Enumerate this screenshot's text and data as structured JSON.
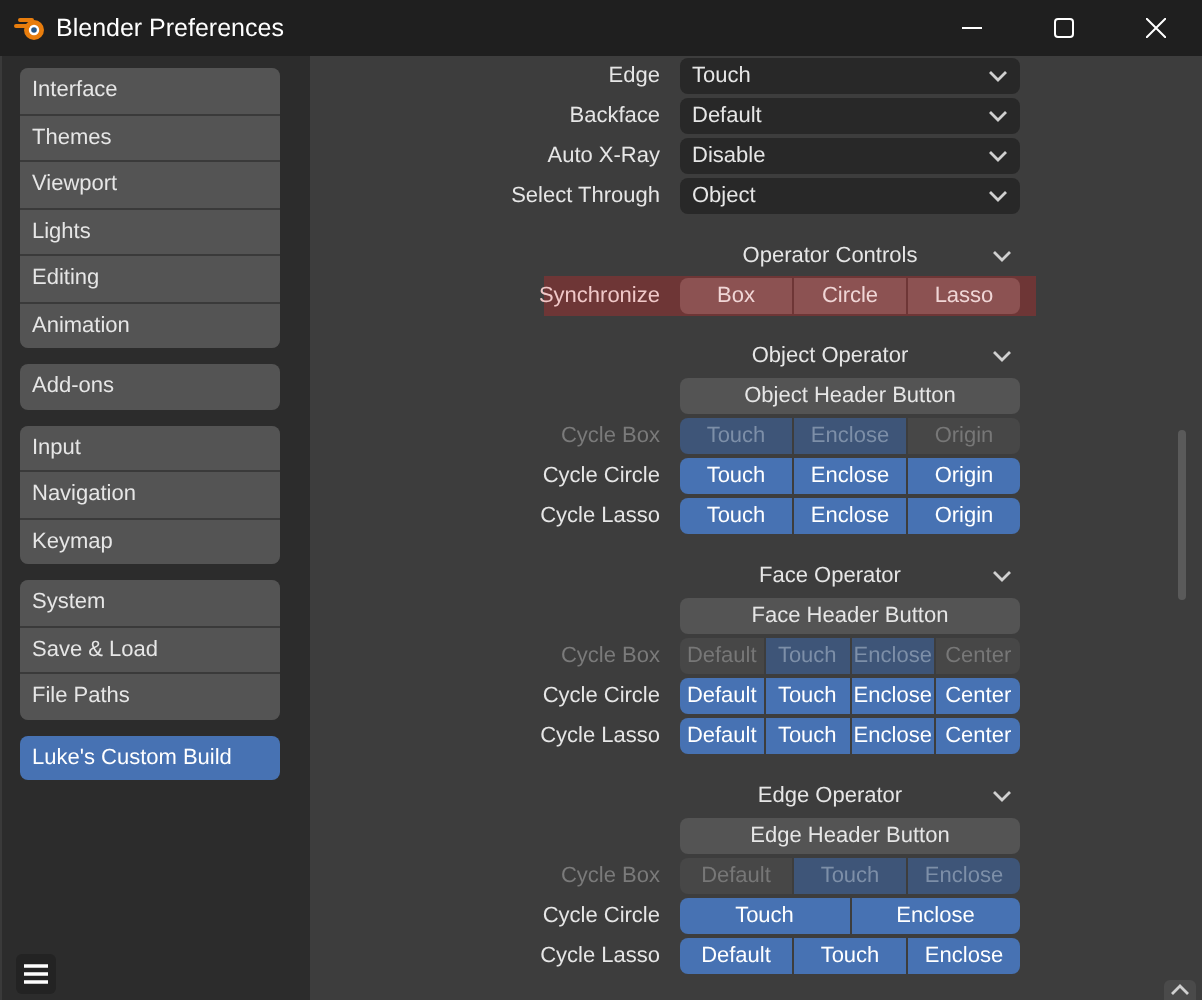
{
  "window": {
    "title": "Blender Preferences"
  },
  "sidebar": {
    "groups": [
      [
        {
          "label": "Interface",
          "selected": false
        },
        {
          "label": "Themes",
          "selected": false
        },
        {
          "label": "Viewport",
          "selected": false
        },
        {
          "label": "Lights",
          "selected": false
        },
        {
          "label": "Editing",
          "selected": false
        },
        {
          "label": "Animation",
          "selected": false
        }
      ],
      [
        {
          "label": "Add-ons",
          "selected": false
        }
      ],
      [
        {
          "label": "Input",
          "selected": false
        },
        {
          "label": "Navigation",
          "selected": false
        },
        {
          "label": "Keymap",
          "selected": false
        }
      ],
      [
        {
          "label": "System",
          "selected": false
        },
        {
          "label": "Save & Load",
          "selected": false
        },
        {
          "label": "File Paths",
          "selected": false
        }
      ],
      [
        {
          "label": "Luke's Custom Build",
          "selected": true
        }
      ]
    ]
  },
  "settings": [
    {
      "label": "Edge",
      "value": "Touch"
    },
    {
      "label": "Backface",
      "value": "Default"
    },
    {
      "label": "Auto X-Ray",
      "value": "Disable"
    },
    {
      "label": "Select Through",
      "value": "Object"
    }
  ],
  "sections": [
    {
      "title": "Operator Controls",
      "expanded": true,
      "rows": [
        {
          "label": "Synchronize",
          "alert": true,
          "options": [
            {
              "label": "Box"
            },
            {
              "label": "Circle"
            },
            {
              "label": "Lasso"
            }
          ]
        }
      ]
    },
    {
      "title": "Object Operator",
      "expanded": true,
      "header_button": "Object Header Button",
      "rows": [
        {
          "label": "Cycle Box",
          "alert": false,
          "disabled": true,
          "options": [
            {
              "label": "Touch",
              "selected": true
            },
            {
              "label": "Enclose",
              "selected": true
            },
            {
              "label": "Origin",
              "selected": false
            }
          ]
        },
        {
          "label": "Cycle Circle",
          "alert": false,
          "disabled": false,
          "options": [
            {
              "label": "Touch",
              "selected": true
            },
            {
              "label": "Enclose",
              "selected": true
            },
            {
              "label": "Origin",
              "selected": true
            }
          ]
        },
        {
          "label": "Cycle Lasso",
          "alert": false,
          "disabled": false,
          "options": [
            {
              "label": "Touch",
              "selected": true
            },
            {
              "label": "Enclose",
              "selected": true
            },
            {
              "label": "Origin",
              "selected": true
            }
          ]
        }
      ]
    },
    {
      "title": "Face Operator",
      "expanded": true,
      "header_button": "Face Header Button",
      "rows": [
        {
          "label": "Cycle Box",
          "alert": false,
          "disabled": true,
          "options": [
            {
              "label": "Default",
              "selected": false
            },
            {
              "label": "Touch",
              "selected": true
            },
            {
              "label": "Enclose",
              "selected": true
            },
            {
              "label": "Center",
              "selected": false
            }
          ]
        },
        {
          "label": "Cycle Circle",
          "alert": false,
          "disabled": false,
          "options": [
            {
              "label": "Default",
              "selected": true
            },
            {
              "label": "Touch",
              "selected": true
            },
            {
              "label": "Enclose",
              "selected": true
            },
            {
              "label": "Center",
              "selected": true
            }
          ]
        },
        {
          "label": "Cycle Lasso",
          "alert": false,
          "disabled": false,
          "options": [
            {
              "label": "Default",
              "selected": true
            },
            {
              "label": "Touch",
              "selected": true
            },
            {
              "label": "Enclose",
              "selected": true
            },
            {
              "label": "Center",
              "selected": true
            }
          ]
        }
      ]
    },
    {
      "title": "Edge Operator",
      "expanded": true,
      "header_button": "Edge Header Button",
      "rows": [
        {
          "label": "Cycle Box",
          "alert": false,
          "disabled": true,
          "options": [
            {
              "label": "Default",
              "selected": false
            },
            {
              "label": "Touch",
              "selected": true
            },
            {
              "label": "Enclose",
              "selected": true
            }
          ]
        },
        {
          "label": "Cycle Circle",
          "alert": false,
          "disabled": false,
          "options": [
            {
              "label": "Touch",
              "selected": true
            },
            {
              "label": "Enclose",
              "selected": true
            }
          ]
        },
        {
          "label": "Cycle Lasso",
          "alert": false,
          "disabled": false,
          "options": [
            {
              "label": "Default",
              "selected": true
            },
            {
              "label": "Touch",
              "selected": true
            },
            {
              "label": "Enclose",
              "selected": true
            }
          ]
        }
      ]
    }
  ]
}
